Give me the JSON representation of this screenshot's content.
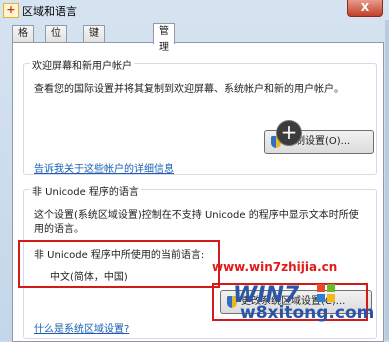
{
  "window": {
    "title": "区域和语言",
    "close_label": "X"
  },
  "tabs": [
    {
      "label": "格式"
    },
    {
      "label": "位置"
    },
    {
      "label": "键盘和语言"
    },
    {
      "label": "管理",
      "active": true
    }
  ],
  "welcome_group": {
    "title": "欢迎屏幕和新用户帐户",
    "description": "查看您的国际设置并将其复制到欢迎屏幕、系统帐户和新的用户帐户。",
    "copy_button_label": "复制设置(O)...",
    "link": "告诉我关于这些帐户的详细信息"
  },
  "unicode_group": {
    "title": "非 Unicode 程序的语言",
    "description_line1": "这个设置(系统区域设置)控制在不支持 Unicode 的程序中显示文本时所使",
    "description_line2": "用的语言。",
    "current_label": "非 Unicode 程序中所使用的当前语言:",
    "current_value": "中文(简体，中国)",
    "change_button_label": "更改系统区域设置(C)...",
    "link": "什么是系统区域设置?"
  },
  "overlays": {
    "plus_badge": "+",
    "watermark_url": "www.win7zhijia.cn",
    "logo_text": "WIN7",
    "watermark_site": "w8xitong.com"
  }
}
